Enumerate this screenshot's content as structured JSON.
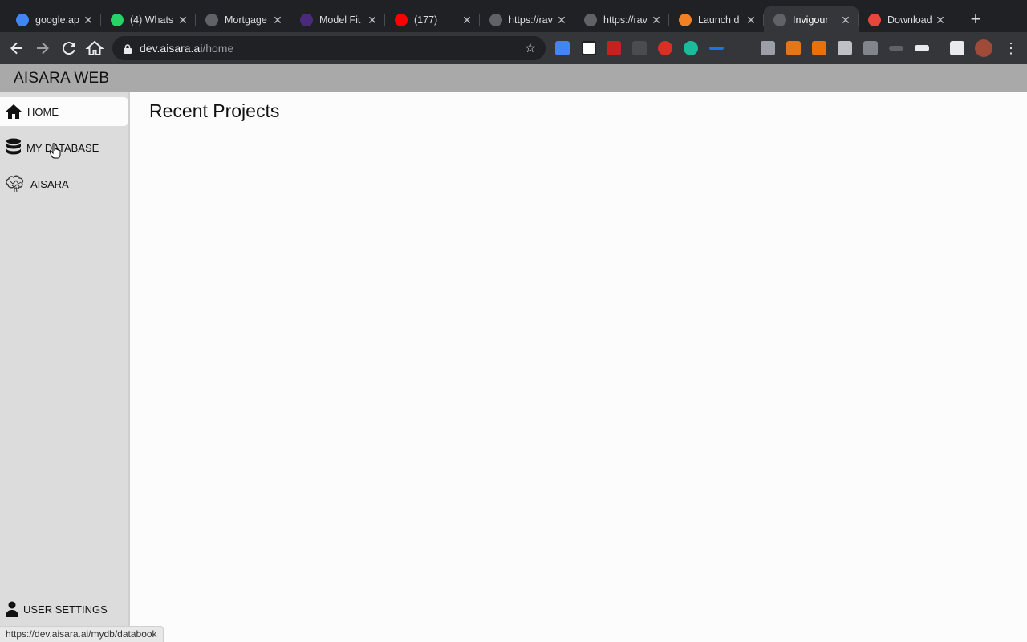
{
  "browser": {
    "tabs": [
      {
        "title": "google.ap",
        "favicon": "google-cloud-icon",
        "color": "#4285f4"
      },
      {
        "title": "(4) Whats",
        "favicon": "whatsapp-icon",
        "color": "#25d366"
      },
      {
        "title": "Mortgage",
        "favicon": "globe-icon",
        "color": "#5f6368"
      },
      {
        "title": "Model Fit",
        "favicon": "w-icon",
        "color": "#4b2a7b"
      },
      {
        "title": "(177)",
        "favicon": "youtube-icon",
        "color": "#ff0000"
      },
      {
        "title": "https://rav",
        "favicon": "globe-icon",
        "color": "#5f6368"
      },
      {
        "title": "https://rav",
        "favicon": "globe-icon",
        "color": "#5f6368"
      },
      {
        "title": "Launch d",
        "favicon": "stackoverflow-icon",
        "color": "#f48024"
      },
      {
        "title": "Invigour",
        "favicon": "globe-icon",
        "color": "#5f6368",
        "active": true
      },
      {
        "title": "Download",
        "favicon": "download-site-icon",
        "color": "#e8453c"
      }
    ],
    "url_host": "dev.aisara.ai",
    "url_path": "/home",
    "status_url": "https://dev.aisara.ai/mydb/databook"
  },
  "app": {
    "title": "AISARA WEB",
    "nav": {
      "home": "HOME",
      "my_database": "MY DATABASE",
      "aisara": "AISARA",
      "user_settings": "USER SETTINGS"
    },
    "page_title": "Recent Projects"
  },
  "colors": {
    "header_bg": "#a9a9a9",
    "sidebar_bg": "#dcdcdc",
    "main_bg": "#fcfcfc"
  }
}
